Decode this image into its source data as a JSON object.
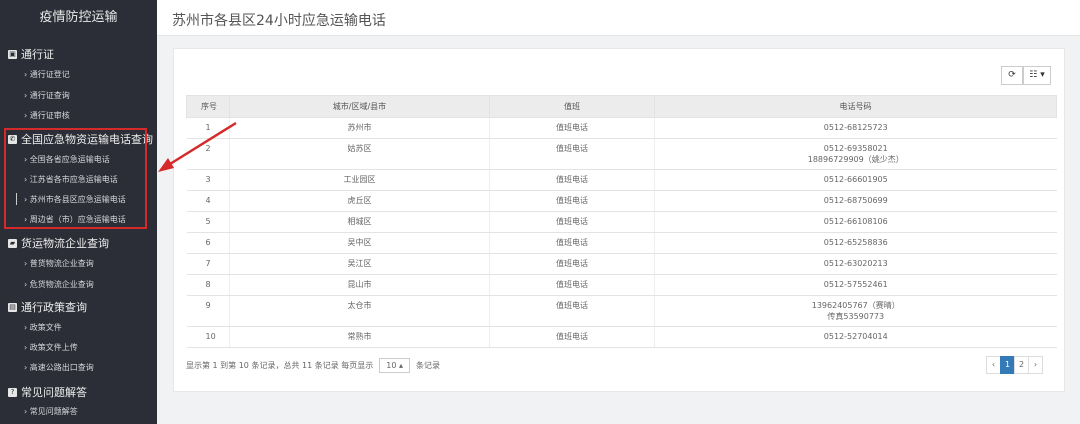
{
  "sidebar": {
    "brand": "疫情防控运输",
    "groups": [
      {
        "label": "通行证",
        "items": [
          "通行证登记",
          "通行证查询",
          "通行证审核"
        ]
      },
      {
        "label": "全国应急物资运输电话查询",
        "items": [
          "全国各省应急运输电话",
          "江苏省各市应急运输电话",
          "苏州市各县区应急运输电话",
          "周边省（市）应急运输电话"
        ]
      },
      {
        "label": "货运物流企业查询",
        "items": [
          "普货物流企业查询",
          "危货物流企业查询"
        ]
      },
      {
        "label": "通行政策查询",
        "items": [
          "政策文件",
          "政策文件上传",
          "高速公路出口查询"
        ]
      },
      {
        "label": "常见问题解答",
        "items": [
          "常见问题解答"
        ]
      }
    ]
  },
  "header": {
    "title": "苏州市各县区24小时应急运输电话"
  },
  "toolbar": {
    "refresh": "⟳",
    "columns": "☷ ▾"
  },
  "table": {
    "headers": [
      "序号",
      "城市/区域/县市",
      "值班",
      "电话号码"
    ],
    "rows": [
      [
        "1",
        "苏州市",
        "值班电话",
        "0512-68125723"
      ],
      [
        "2",
        "姑苏区",
        "值班电话",
        "0512-69358021\n18896729909（姚少杰）"
      ],
      [
        "3",
        "工业园区",
        "值班电话",
        "0512-66601905"
      ],
      [
        "4",
        "虎丘区",
        "值班电话",
        "0512-68750699"
      ],
      [
        "5",
        "相城区",
        "值班电话",
        "0512-66108106"
      ],
      [
        "6",
        "吴中区",
        "值班电话",
        "0512-65258836"
      ],
      [
        "7",
        "吴江区",
        "值班电话",
        "0512-63020213"
      ],
      [
        "8",
        "昆山市",
        "值班电话",
        "0512-57552461"
      ],
      [
        "9",
        "太仓市",
        "值班电话",
        "13962405767（赛晴）\n传真53590773"
      ],
      [
        "10",
        "常熟市",
        "值班电话",
        "0512-52704014"
      ]
    ]
  },
  "footer": {
    "summary": "显示第 1 到第 10 条记录，总共 11 条记录 每页显示",
    "page_size": "10 ▴",
    "suffix": "条记录"
  },
  "pager": {
    "prev": "‹",
    "pages": [
      "1",
      "2"
    ],
    "next": "›",
    "current": "1"
  },
  "colors": {
    "sidebar": "#2b2e36",
    "highlight": "#d62a2a",
    "accent": "#337ab7"
  }
}
